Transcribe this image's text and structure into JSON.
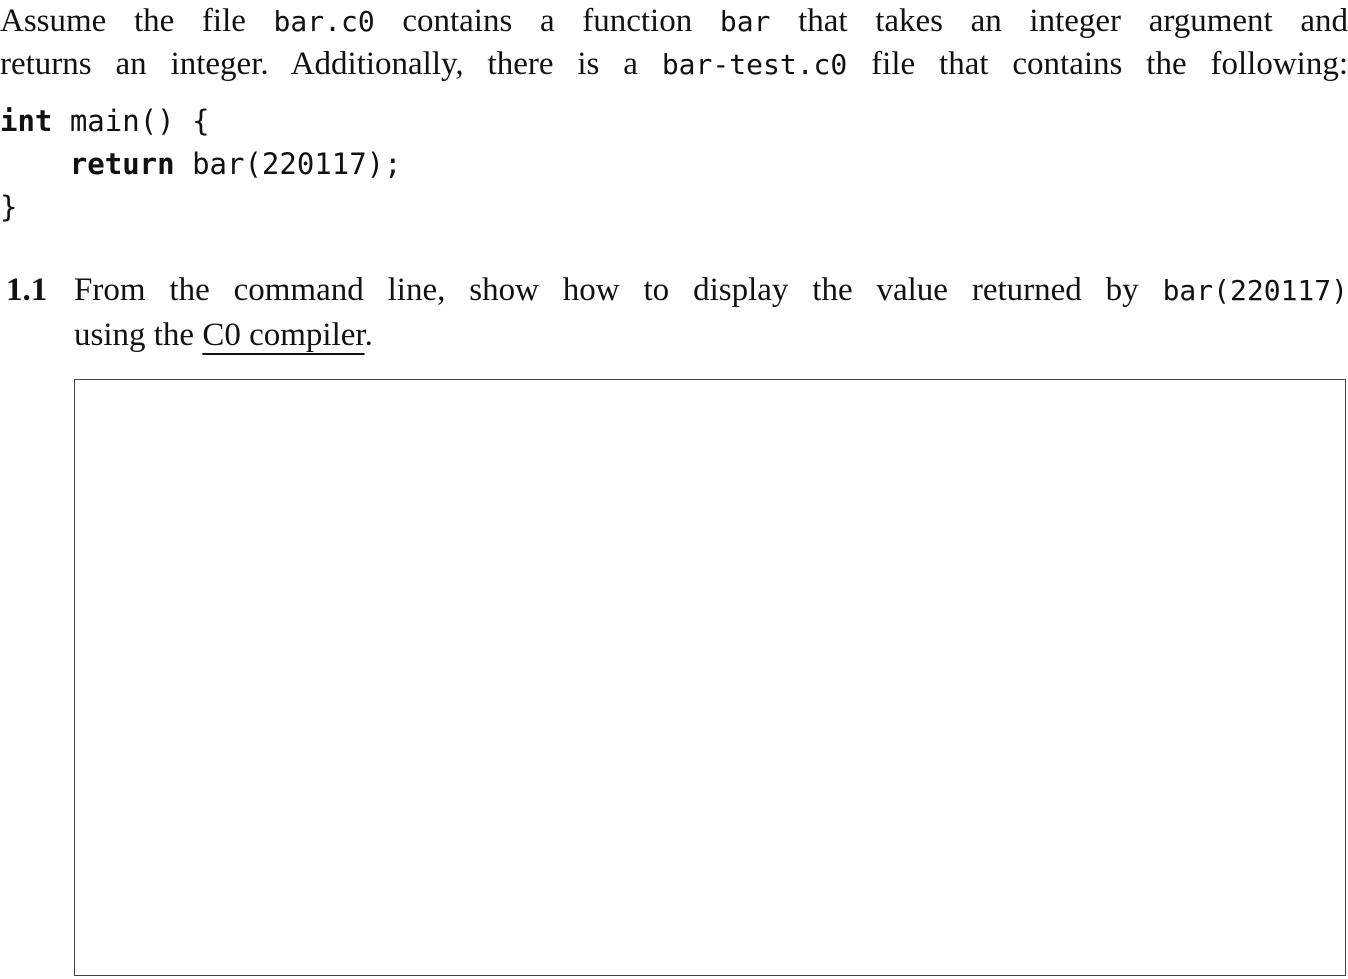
{
  "intro": {
    "line1": {
      "t1": "Assume the file ",
      "c1": "bar.c0",
      "t2": " contains a function ",
      "c2": "bar",
      "t3": " that takes an integer argument and"
    },
    "line2": {
      "t1": "returns an integer.  Additionally, there is a ",
      "c1": "bar-test.c0",
      "t2": " file that contains the following:"
    }
  },
  "code": {
    "line1_kw": "int",
    "line1_rest": " main() {",
    "line2_indent": "    ",
    "line2_kw": "return",
    "line2_rest": " bar(220117);",
    "line3": "}"
  },
  "question": {
    "number": "1.1",
    "line1_text": "From the command line, show how to display the value returned by ",
    "line1_code": "bar(220117)",
    "line2_pre": "using the ",
    "line2_link": "C0 compiler",
    "line2_post": "."
  },
  "answer_box": {
    "value": ""
  }
}
